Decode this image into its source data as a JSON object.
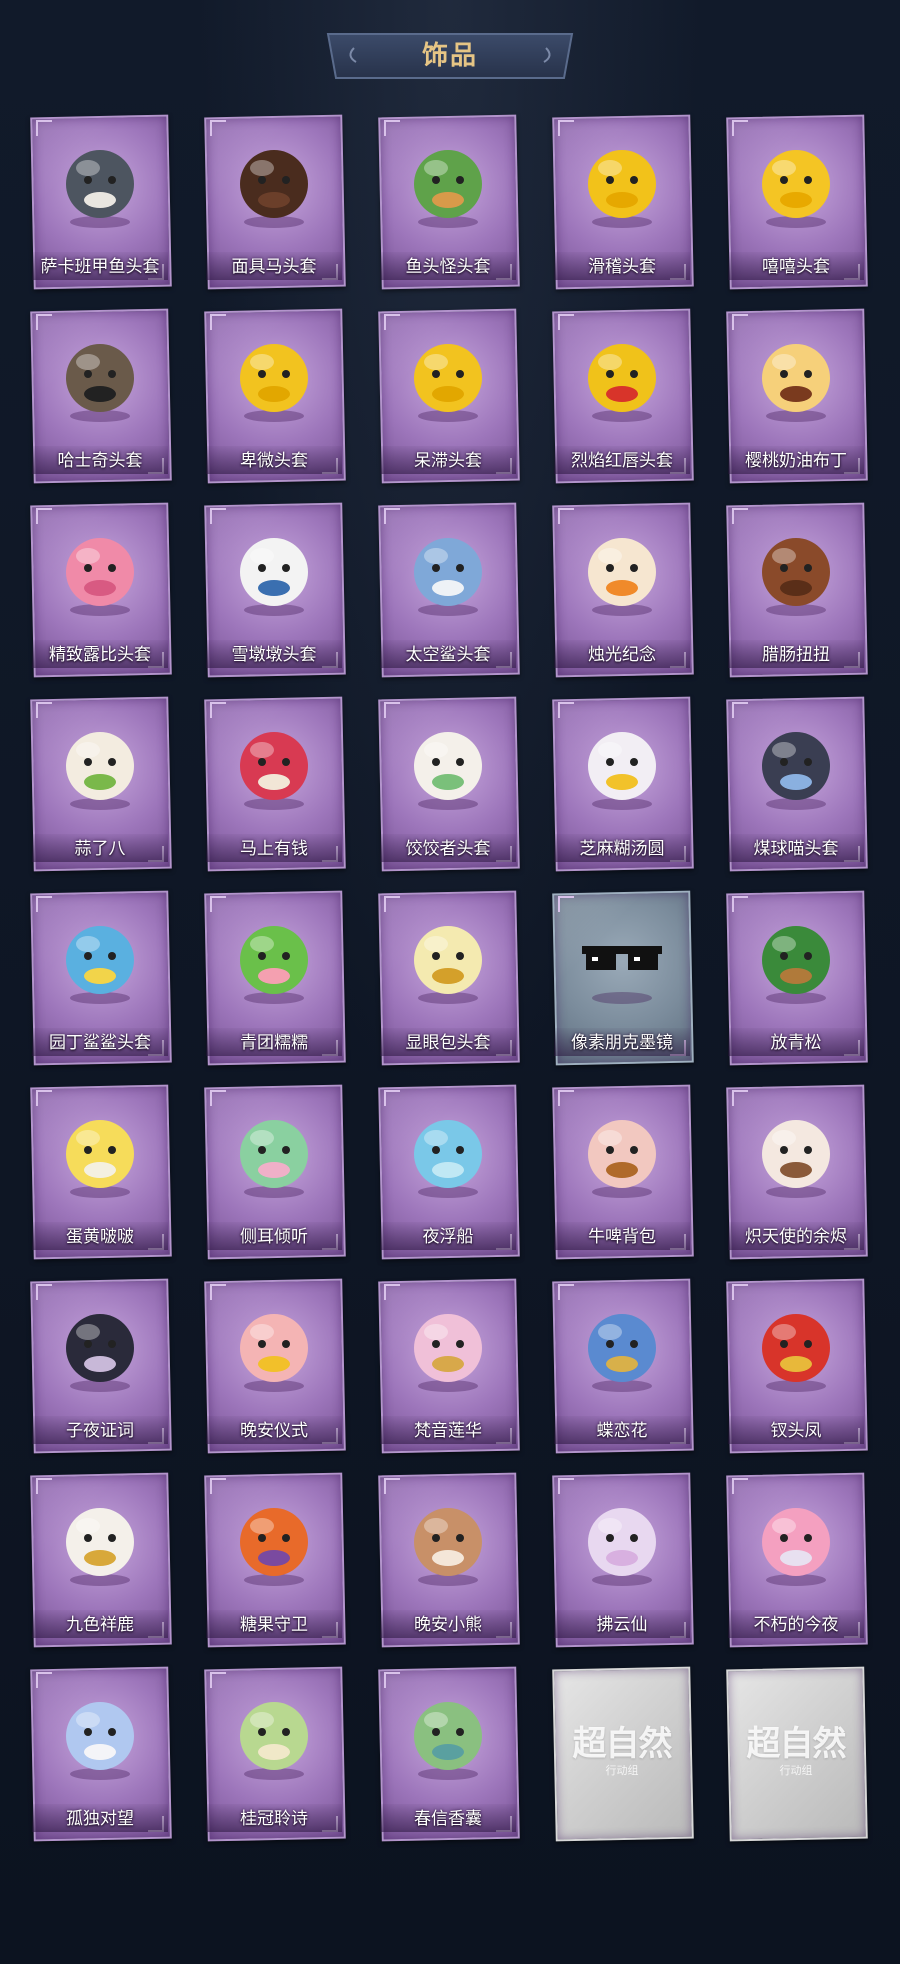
{
  "header": {
    "title": "饰品"
  },
  "colors": {
    "background": "#0d1421",
    "title": "#e6c585",
    "card": "#9d76bb",
    "label": "#ffffff"
  },
  "items": [
    {
      "label": "萨卡班甲鱼头套",
      "art": "fish-head-icon",
      "variant": "purple",
      "c1": "#4d5560",
      "c2": "#e9e6e0"
    },
    {
      "label": "面具马头套",
      "art": "horse-head-icon",
      "variant": "purple",
      "c1": "#4a2c1e",
      "c2": "#6b3f2a"
    },
    {
      "label": "鱼头怪头套",
      "art": "fish-monster-head-icon",
      "variant": "purple",
      "c1": "#5fa24a",
      "c2": "#d89a4a"
    },
    {
      "label": "滑稽头套",
      "art": "silly-face-icon",
      "variant": "purple",
      "c1": "#f2c21a",
      "c2": "#e6a800"
    },
    {
      "label": "嘻嘻头套",
      "art": "grin-face-icon",
      "variant": "purple",
      "c1": "#f4c524",
      "c2": "#e8a900"
    },
    {
      "label": "哈士奇头套",
      "art": "husky-head-icon",
      "variant": "purple",
      "c1": "#6a5a4a",
      "c2": "#222222"
    },
    {
      "label": "卑微头套",
      "art": "humble-face-icon",
      "variant": "purple",
      "c1": "#f2c31f",
      "c2": "#e2a700"
    },
    {
      "label": "呆滞头套",
      "art": "dazed-face-icon",
      "variant": "purple",
      "c1": "#f2c31f",
      "c2": "#e2a700"
    },
    {
      "label": "烈焰红唇头套",
      "art": "pikachu-head-icon",
      "variant": "purple",
      "c1": "#f0c21a",
      "c2": "#d8342a"
    },
    {
      "label": "樱桃奶油布丁",
      "art": "pudding-icon",
      "variant": "purple",
      "c1": "#f6d07a",
      "c2": "#7a3a1e"
    },
    {
      "label": "精致露比头套",
      "art": "pink-beaver-icon",
      "variant": "purple",
      "c1": "#f08aa8",
      "c2": "#d85a82"
    },
    {
      "label": "雪墩墩头套",
      "art": "snowman-head-icon",
      "variant": "purple",
      "c1": "#f3f3f3",
      "c2": "#3a6fb0"
    },
    {
      "label": "太空鲨头套",
      "art": "shark-head-icon",
      "variant": "purple",
      "c1": "#7fa8d8",
      "c2": "#eef2f6"
    },
    {
      "label": "烛光纪念",
      "art": "candle-icon",
      "variant": "purple",
      "c1": "#f6e6d0",
      "c2": "#f08a2a"
    },
    {
      "label": "腊肠扭扭",
      "art": "dachshund-icon",
      "variant": "purple",
      "c1": "#8a4a2a",
      "c2": "#5a2e18"
    },
    {
      "label": "蒜了八",
      "art": "garlic-icon",
      "variant": "purple",
      "c1": "#f3ece0",
      "c2": "#7ab84a"
    },
    {
      "label": "马上有钱",
      "art": "red-horse-icon",
      "variant": "purple",
      "c1": "#d83a52",
      "c2": "#f2e6d6"
    },
    {
      "label": "饺饺者头套",
      "art": "dumpling-icon",
      "variant": "purple",
      "c1": "#f4f0ea",
      "c2": "#7ac07a"
    },
    {
      "label": "芝麻糊汤圆",
      "art": "rice-ball-icon",
      "variant": "purple",
      "c1": "#f2eef4",
      "c2": "#f2c22a"
    },
    {
      "label": "煤球喵头套",
      "art": "black-cat-icon",
      "variant": "purple",
      "c1": "#3a3e52",
      "c2": "#8ab0e0"
    },
    {
      "label": "园丁鲨鲨头套",
      "art": "gardener-shark-icon",
      "variant": "purple",
      "c1": "#5ab0e0",
      "c2": "#f2d44a"
    },
    {
      "label": "青团糯糯",
      "art": "green-rice-ball-icon",
      "variant": "purple",
      "c1": "#6ac04a",
      "c2": "#f4a0b0"
    },
    {
      "label": "显眼包头套",
      "art": "lightbulb-head-icon",
      "variant": "purple",
      "c1": "#f4eab0",
      "c2": "#d4a02a"
    },
    {
      "label": "像素朋克墨镜",
      "art": "pixel-sunglasses-icon",
      "variant": "grey",
      "c1": "#111111",
      "c2": "#ffffff"
    },
    {
      "label": "放青松",
      "art": "bonsai-icon",
      "variant": "purple",
      "c1": "#3a8a3a",
      "c2": "#b07a3a"
    },
    {
      "label": "蛋黄啵啵",
      "art": "chick-icon",
      "variant": "purple",
      "c1": "#f6dc5a",
      "c2": "#f4f0e0"
    },
    {
      "label": "侧耳倾听",
      "art": "flower-wreath-icon",
      "variant": "purple",
      "c1": "#8ad0a0",
      "c2": "#f0b0c8"
    },
    {
      "label": "夜浮船",
      "art": "jellyfish-icon",
      "variant": "purple",
      "c1": "#7ac8e8",
      "c2": "#c0e8f4"
    },
    {
      "label": "牛啤背包",
      "art": "beer-cow-icon",
      "variant": "purple",
      "c1": "#f2c8c0",
      "c2": "#b06a2a"
    },
    {
      "label": "炽天使的余烬",
      "art": "angel-icon",
      "variant": "purple",
      "c1": "#f4e8e0",
      "c2": "#8a5a3a"
    },
    {
      "label": "子夜证词",
      "art": "owl-icon",
      "variant": "purple",
      "c1": "#2a2a3a",
      "c2": "#c8b8d8"
    },
    {
      "label": "晚安仪式",
      "art": "pig-doll-icon",
      "variant": "purple",
      "c1": "#f4b4b4",
      "c2": "#f2c02a"
    },
    {
      "label": "梵音莲华",
      "art": "lotus-doll-icon",
      "variant": "purple",
      "c1": "#f0c0d8",
      "c2": "#d8a84a"
    },
    {
      "label": "蝶恋花",
      "art": "butterfly-bell-icon",
      "variant": "purple",
      "c1": "#5a8ad0",
      "c2": "#d8b04a"
    },
    {
      "label": "钗头凤",
      "art": "phoenix-crown-icon",
      "variant": "purple",
      "c1": "#d8342a",
      "c2": "#e8b83a"
    },
    {
      "label": "九色祥鹿",
      "art": "deer-icon",
      "variant": "purple",
      "c1": "#f4f0ea",
      "c2": "#d8a83a"
    },
    {
      "label": "糖果守卫",
      "art": "scarecrow-icon",
      "variant": "purple",
      "c1": "#e86a2a",
      "c2": "#7a4aa0"
    },
    {
      "label": "晚安小熊",
      "art": "bear-icon",
      "variant": "purple",
      "c1": "#c89068",
      "c2": "#f4e6d8"
    },
    {
      "label": "拂云仙",
      "art": "immortal-doll-icon",
      "variant": "purple",
      "c1": "#e8d8f0",
      "c2": "#d8b0e0"
    },
    {
      "label": "不朽的今夜",
      "art": "pink-cat-bowl-icon",
      "variant": "purple",
      "c1": "#f4a0c0",
      "c2": "#e8e0f0"
    },
    {
      "label": "孤独对望",
      "art": "moon-doll-icon",
      "variant": "purple",
      "c1": "#b0c8f0",
      "c2": "#f4f4f8"
    },
    {
      "label": "桂冠聆诗",
      "art": "laurel-doll-icon",
      "variant": "purple",
      "c1": "#b8d890",
      "c2": "#f0e8c8"
    },
    {
      "label": "春信香囊",
      "art": "sachet-icon",
      "variant": "purple",
      "c1": "#8ac080",
      "c2": "#5aa0a0"
    },
    {
      "label": "",
      "art": "placeholder-logo-icon",
      "variant": "silver",
      "logo": "超自然",
      "sub": "行动组"
    },
    {
      "label": "",
      "art": "placeholder-logo-icon",
      "variant": "silver",
      "logo": "超自然",
      "sub": "行动组"
    }
  ]
}
